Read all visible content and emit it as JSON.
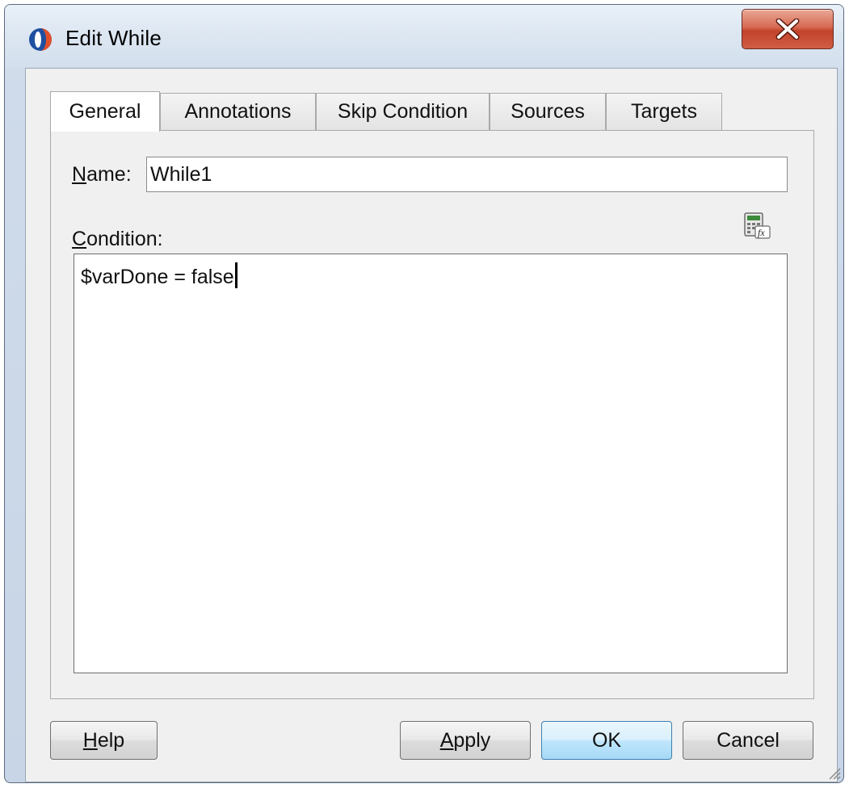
{
  "window": {
    "title": "Edit While",
    "close_label": "X"
  },
  "tabs": [
    {
      "label": "General",
      "active": true
    },
    {
      "label": "Annotations",
      "active": false
    },
    {
      "label": "Skip Condition",
      "active": false
    },
    {
      "label": "Sources",
      "active": false
    },
    {
      "label": "Targets",
      "active": false
    }
  ],
  "general": {
    "name_label_mnemonic": "N",
    "name_label_rest": "ame:",
    "name_value": "While1",
    "condition_label_mnemonic": "C",
    "condition_label_rest": "ondition:",
    "condition_value": "$varDone = false"
  },
  "buttons": {
    "help_mnemonic": "H",
    "help_rest": "elp",
    "apply_mnemonic": "A",
    "apply_rest": "pply",
    "ok": "OK",
    "cancel": "Cancel"
  },
  "icons": {
    "app": "oracle-jdev-icon",
    "expression_builder": "expression-builder-icon",
    "close": "close-icon",
    "resize_grip": "resize-grip-icon"
  },
  "colors": {
    "close_button": "#c2432a",
    "default_button_border": "#3c7fb1"
  }
}
